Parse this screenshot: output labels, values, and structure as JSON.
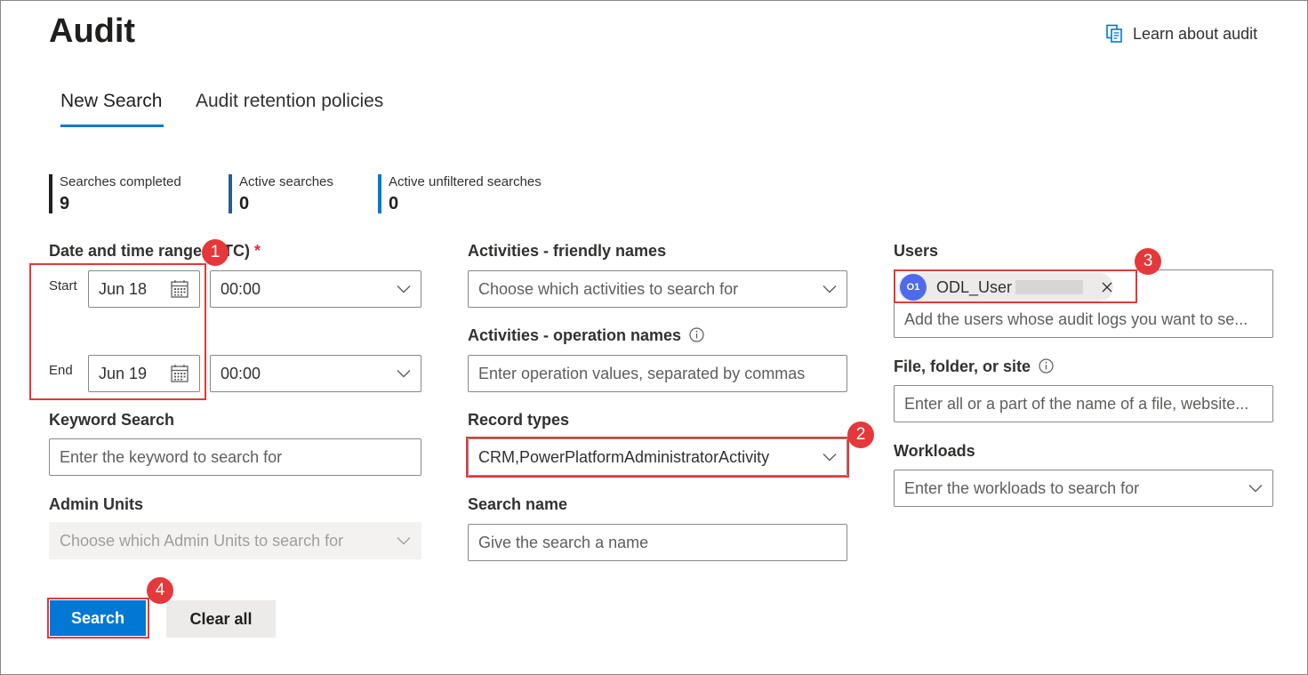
{
  "header": {
    "title": "Audit",
    "learn_link": "Learn about audit"
  },
  "tabs": [
    {
      "label": "New Search",
      "active": true
    },
    {
      "label": "Audit retention policies",
      "active": false
    }
  ],
  "stats": [
    {
      "label": "Searches completed",
      "value": "9",
      "color": "#201f1e"
    },
    {
      "label": "Active searches",
      "value": "0",
      "color": "#2b5c8a"
    },
    {
      "label": "Active unfiltered searches",
      "value": "0",
      "color": "#0078d4"
    }
  ],
  "date_range": {
    "label": "Date and time range (UTC)",
    "required_mark": "*",
    "start_label": "Start",
    "start_date": "Jun 18",
    "start_time": "00:00",
    "end_label": "End",
    "end_date": "Jun 19",
    "end_time": "00:00"
  },
  "keyword": {
    "label": "Keyword Search",
    "placeholder": "Enter the keyword to search for"
  },
  "admin_units": {
    "label": "Admin Units",
    "placeholder": "Choose which Admin Units to search for"
  },
  "activities_friendly": {
    "label": "Activities - friendly names",
    "placeholder": "Choose which activities to search for"
  },
  "activities_operation": {
    "label": "Activities - operation names",
    "placeholder": "Enter operation values, separated by commas"
  },
  "record_types": {
    "label": "Record types",
    "value": "CRM,PowerPlatformAdministratorActivity"
  },
  "search_name": {
    "label": "Search name",
    "placeholder": "Give the search a name"
  },
  "users": {
    "label": "Users",
    "chip_initials": "O1",
    "chip_name": "ODL_User",
    "placeholder": "Add the users whose audit logs you want to se..."
  },
  "file_folder_site": {
    "label": "File, folder, or site",
    "placeholder": "Enter all or a part of the name of a file, website..."
  },
  "workloads": {
    "label": "Workloads",
    "placeholder": "Enter the workloads to search for"
  },
  "buttons": {
    "search": "Search",
    "clear_all": "Clear all"
  },
  "callouts": [
    "1",
    "2",
    "3",
    "4"
  ],
  "colors": {
    "accent": "#0078d4",
    "callout": "#e5383b",
    "avatar": "#4f6bed"
  }
}
